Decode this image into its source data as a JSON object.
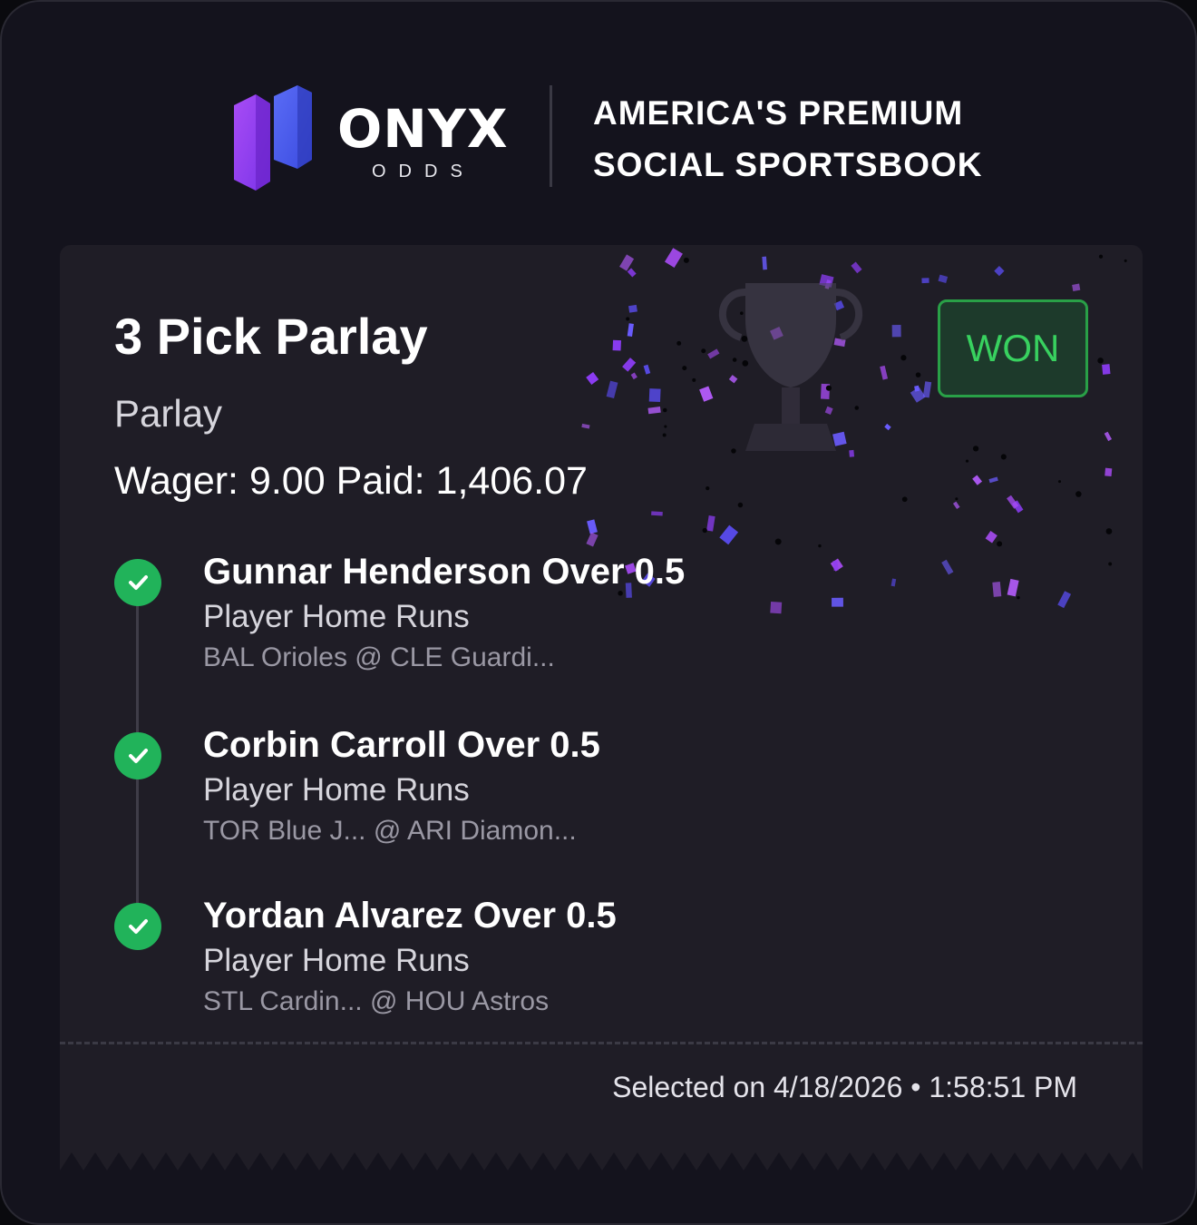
{
  "brand": {
    "name": "ONYX",
    "sub": "ODDS",
    "tagline_line1": "AMERICA'S PREMIUM",
    "tagline_line2": "SOCIAL SPORTSBOOK"
  },
  "colors": {
    "background": "#14131d",
    "card": "#1f1d26",
    "accent_purple": "#8b3cf2",
    "accent_blue": "#4a5cf0",
    "success_green": "#21b35a"
  },
  "bet": {
    "title": "3 Pick Parlay",
    "type": "Parlay",
    "wager_line": "Wager: 9.00 Paid: 1,406.07",
    "status": "WON",
    "picks": [
      {
        "name": "Gunnar Henderson Over 0.5",
        "market": "Player Home Runs",
        "game": "BAL Orioles @ CLE Guardi...",
        "result_icon": "check-icon"
      },
      {
        "name": "Corbin Carroll Over 0.5",
        "market": "Player Home Runs",
        "game": "TOR Blue J... @ ARI Diamon...",
        "result_icon": "check-icon"
      },
      {
        "name": "Yordan Alvarez Over 0.5",
        "market": "Player Home Runs",
        "game": "STL Cardin... @ HOU Astros",
        "result_icon": "check-icon"
      }
    ],
    "selected_on": "Selected on 4/18/2026 • 1:58:51 PM"
  },
  "decorations": {
    "trophy_icon": "trophy-icon",
    "confetti": "confetti-graphic"
  }
}
